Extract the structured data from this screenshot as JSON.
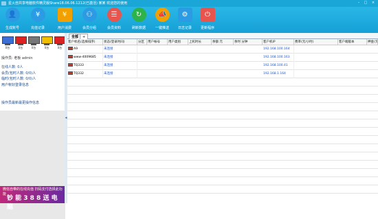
{
  "window": {
    "title": "星火自共享电脑软件精灵版Share18.06.06.1212(已激活)   某某  欢迎您的使用"
  },
  "toolbar": {
    "items": [
      {
        "label": "生成账号",
        "icon": "user-add-icon",
        "color": "#2d9be3"
      },
      {
        "label": "充值记录",
        "icon": "yen-icon",
        "color": "#2d9be3"
      },
      {
        "label": "用户消费",
        "icon": "yen-box-icon",
        "color": "#f2a000"
      },
      {
        "label": "会员分组",
        "icon": "group-icon",
        "color": "#2d9be3"
      },
      {
        "label": "会员资料",
        "icon": "member-icon",
        "color": "#e8554e"
      },
      {
        "label": "刷新数据",
        "icon": "refresh-icon",
        "color": "#2db34a"
      },
      {
        "label": "一键推送",
        "icon": "megaphone-icon",
        "color": "#f2a000"
      },
      {
        "label": "日志记录",
        "icon": "log-icon",
        "color": "#2d9be3"
      },
      {
        "label": "更新程序",
        "icon": "power-icon",
        "color": "#e8554e"
      }
    ]
  },
  "left": {
    "computers": [
      {
        "label": "0台",
        "color": "#3b6fd6"
      },
      {
        "label": "0台",
        "color": "#d22"
      },
      {
        "label": "0台",
        "color": "#777"
      },
      {
        "label": "0台",
        "color": "#f0c000"
      },
      {
        "label": "0台",
        "color": "#d22"
      }
    ],
    "operator": "操作员: 老板  admin",
    "online": "在线人数: 0人",
    "member_online": "会员(包时人数: 0/0)人",
    "temp_online": "临时(包时人数: 0/0)人",
    "login_link": "用户帐好登录信息",
    "notice": "操作员最新最更操作信息",
    "ad_line1": "微信自带的在线充值  扫码支付选择此功能",
    "ad_big": "钞 能 3 8 8 送 电 脑"
  },
  "tabs": {
    "all": "全部",
    "add": "+"
  },
  "table": {
    "columns": [
      "客户机名(选择排序)",
      "状态(登录时间)",
      "分区",
      "用户帐号",
      "用户类别",
      "上机时长",
      "余额 元",
      "余时 分钟",
      "客户机IP",
      "费率(元/小时)",
      "客户端版本",
      "押金(元"
    ],
    "rows": [
      {
        "name": "A9",
        "status": "未连接",
        "ip": "192.168.100.164"
      },
      {
        "name": "www-4009685",
        "status": "未连接",
        "ip": "192.168.100.163"
      },
      {
        "name": "TQ333",
        "status": "未连接",
        "ip": "192.168.100.41"
      },
      {
        "name": "TQ332",
        "status": "未连接",
        "ip": "192.168.1.164"
      }
    ]
  }
}
